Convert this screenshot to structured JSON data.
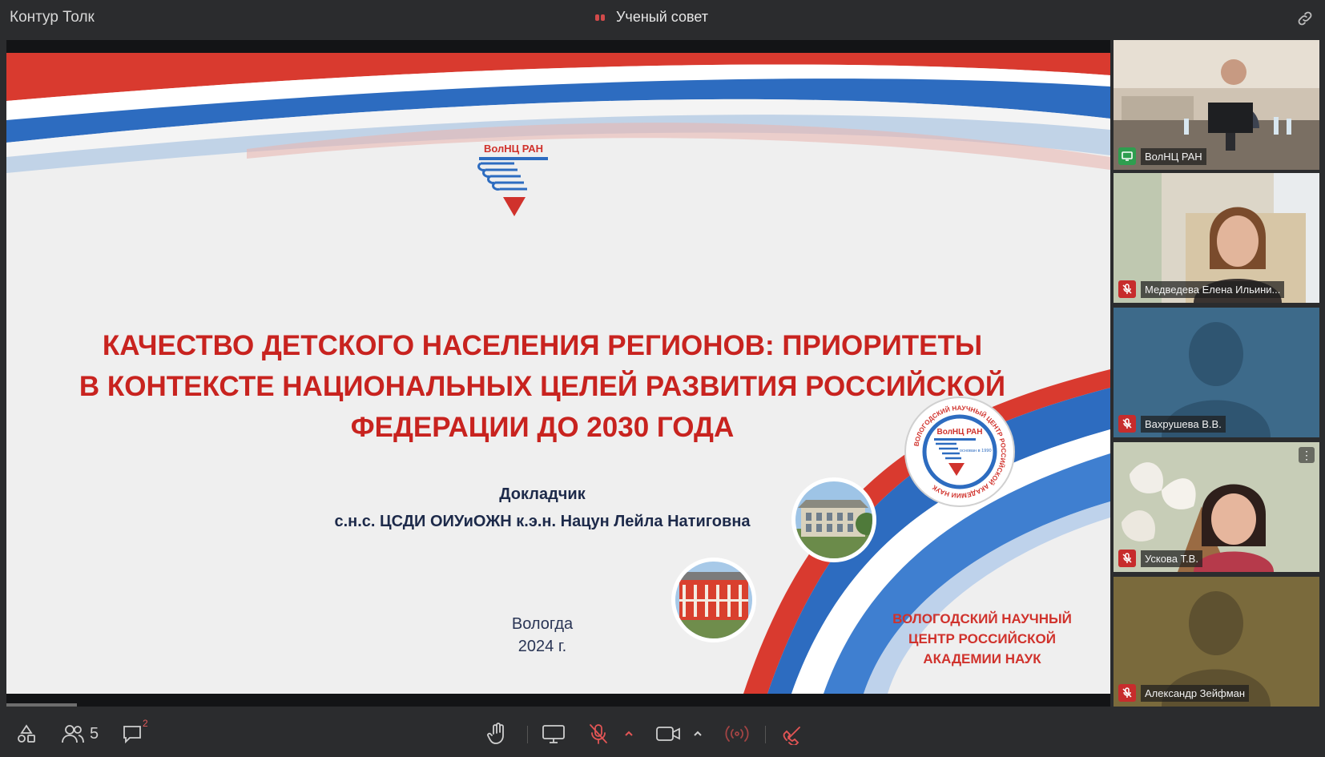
{
  "app": {
    "title": "Контур Толк"
  },
  "meeting": {
    "title": "Ученый совет"
  },
  "slide": {
    "title_lines": [
      "КАЧЕСТВО ДЕТСКОГО НАСЕЛЕНИЯ РЕГИОНОВ: ПРИОРИТЕТЫ",
      "В КОНТЕКСТЕ НАЦИОНАЛЬНЫХ ЦЕЛЕЙ РАЗВИТИЯ РОССИЙСКОЙ",
      "ФЕДЕРАЦИИ ДО 2030 ГОДА"
    ],
    "speaker_label": "Докладчик",
    "speaker_name": "с.н.с. ЦСДИ ОИУиОЖН к.э.н. Нацун Лейла Натиговна",
    "city": "Вологда",
    "year": "2024 г.",
    "logo_text": "ВолНЦ РАН",
    "seal_text": "ВОЛОГОДСКИЙ НАУЧНЫЙ ЦЕНТР РОССИЙСКОЙ АКАДЕМИИ НАУК",
    "seal_inner": "ВолНЦ РАН",
    "seal_founded": "основан в 1990 г.",
    "org_name_lines": [
      "ВОЛОГОДСКИЙ НАУЧНЫЙ",
      "ЦЕНТР РОССИЙСКОЙ",
      "АКАДЕМИИ НАУК"
    ]
  },
  "participants": [
    {
      "name": "ВолНЦ РАН",
      "status": "screen-sharing",
      "active": true
    },
    {
      "name": "Медведева Елена Ильини...",
      "status": "muted"
    },
    {
      "name": "Вахрушева В.В.",
      "status": "muted"
    },
    {
      "name": "Ускова Т.В.",
      "status": "muted"
    },
    {
      "name": "Александр Зейфман",
      "status": "muted"
    }
  ],
  "toolbar": {
    "participants_count": "5",
    "chat_unread": "2"
  },
  "colors": {
    "accent": "#1e88e5",
    "title_red": "#c8231f",
    "muted_red": "#c72c2c",
    "background": "#2b2c2e"
  }
}
